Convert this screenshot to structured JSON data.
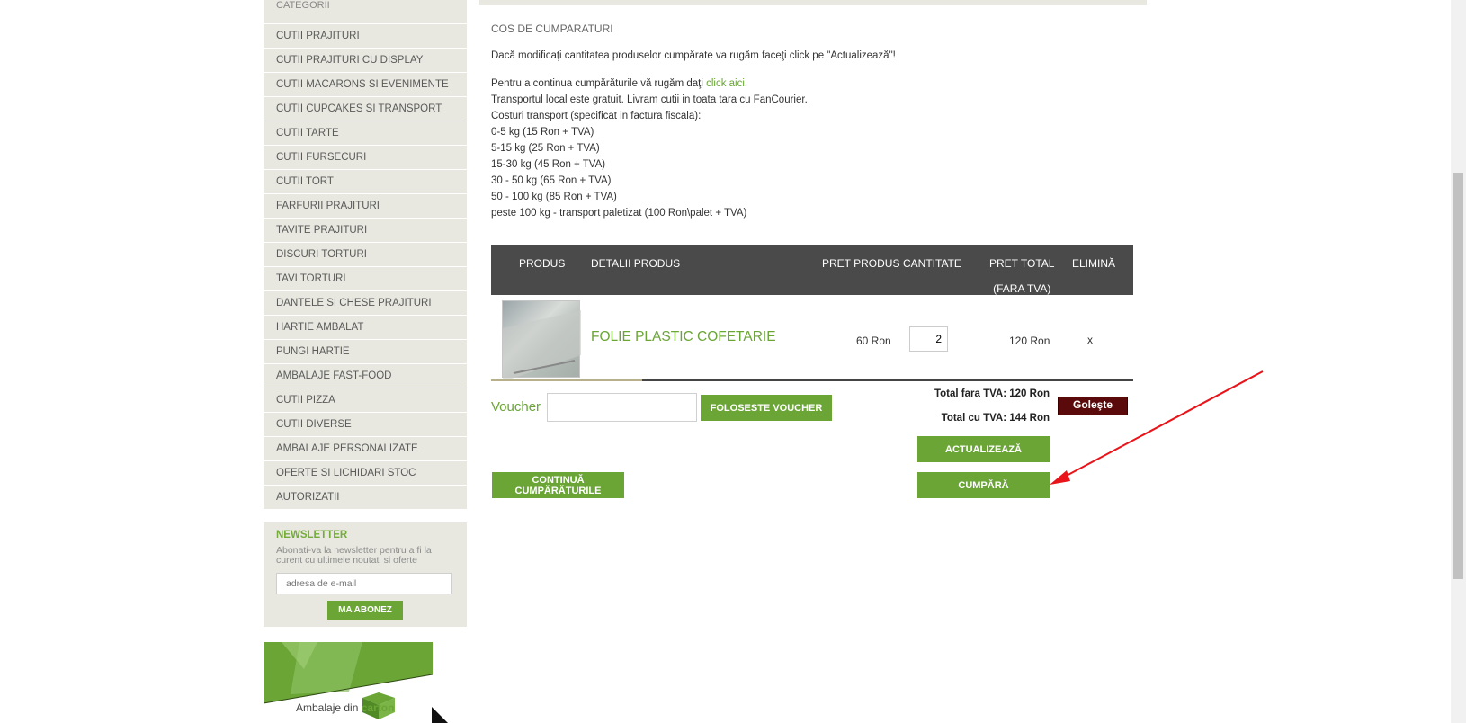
{
  "sidebar": {
    "header": "CATEGORII",
    "items": [
      {
        "label": "CUTII PRAJITURI"
      },
      {
        "label": "CUTII PRAJITURI CU DISPLAY"
      },
      {
        "label": "CUTII MACARONS SI EVENIMENTE"
      },
      {
        "label": "CUTII CUPCAKES SI TRANSPORT"
      },
      {
        "label": "CUTII TARTE"
      },
      {
        "label": "CUTII FURSECURI"
      },
      {
        "label": "CUTII TORT"
      },
      {
        "label": "FARFURII PRAJITURI"
      },
      {
        "label": "TAVITE PRAJITURI"
      },
      {
        "label": "DISCURI TORTURI"
      },
      {
        "label": "TAVI TORTURI"
      },
      {
        "label": "DANTELE SI CHESE PRAJITURI"
      },
      {
        "label": "HARTIE AMBALAT"
      },
      {
        "label": "PUNGI HARTIE"
      },
      {
        "label": "AMBALAJE FAST-FOOD"
      },
      {
        "label": "CUTII PIZZA"
      },
      {
        "label": "CUTII DIVERSE"
      },
      {
        "label": "AMBALAJE PERSONALIZATE"
      },
      {
        "label": "OFERTE SI LICHIDARI STOC"
      },
      {
        "label": "AUTORIZATII"
      }
    ]
  },
  "newsletter": {
    "title": "NEWSLETTER",
    "description": "Abonati-va la newsletter pentru a fi la curent cu ultimele noutati si oferte",
    "placeholder": "adresa de e-mail",
    "button": "MA ABONEZ"
  },
  "banner": {
    "text_prefix": "Ambalaje din ",
    "text_brand": "carton"
  },
  "main": {
    "title": "COS DE CUMPARATURI",
    "intro": "Dacă modificaţi cantitatea produselor cumpărate va rugăm faceţi click pe \"Actualizează\"!",
    "continue_text": "Pentru a continua cumpărăturile vă rugăm daţi ",
    "continue_link": "click aici",
    "continue_end": ".",
    "shipping_lines": [
      "Transportul local este gratuit. Livram cutii in toata tara cu FanCourier.",
      "Costuri transport (specificat in factura fiscala):",
      "0-5 kg (15 Ron + TVA)",
      "5-15 kg (25 Ron + TVA)",
      "15-30 kg (45 Ron + TVA)",
      "30 - 50 kg (65 Ron + TVA)",
      "50 - 100 kg (85 Ron + TVA)",
      "peste 100 kg - transport paletizat (100 Ron\\palet + TVA)"
    ]
  },
  "cart": {
    "columns": {
      "product": "PRODUS",
      "details": "DETALII PRODUS",
      "price": "PRET PRODUS",
      "quantity": "CANTITATE",
      "total": "PRET TOTAL",
      "total_note": "(FARA TVA)",
      "remove": "ELIMINĂ"
    },
    "rows": [
      {
        "name": "FOLIE PLASTIC COFETARIE",
        "price": "60 Ron",
        "quantity": "2",
        "total": "120 Ron",
        "remove": "x"
      }
    ],
    "voucher_label": "Voucher",
    "voucher_button": "FOLOSESTE VOUCHER",
    "total_no_vat": "Total fara TVA: 120 Ron",
    "total_with_vat": "Total cu TVA: 144 Ron",
    "empty_cart": "Goleşte coş",
    "update_button": "ACTUALIZEAZĂ",
    "continue_button": "CONTINUĂ CUMPĂRĂTURILE",
    "buy_button": "CUMPĂRĂ"
  },
  "colors": {
    "accent_green": "#6aa536",
    "header_dark": "#4a4a4a",
    "empty_cart_red": "#5a0a0a",
    "annotation_red": "#e8141a"
  }
}
